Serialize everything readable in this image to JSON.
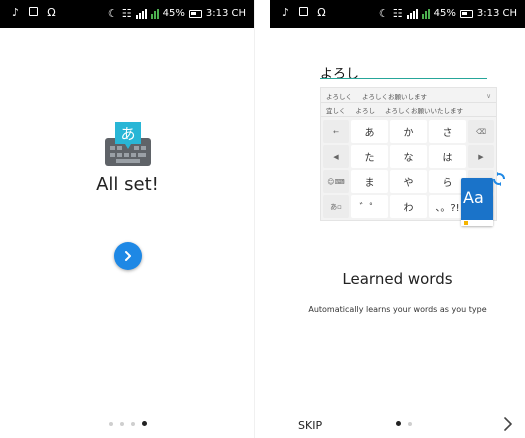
{
  "status_bar": {
    "battery": "45%",
    "time": "3:13 CH"
  },
  "screen_left": {
    "title": "All set!",
    "logo_glyph": "あ",
    "pager": {
      "count": 4,
      "active_index": 3
    }
  },
  "screen_right": {
    "input_text": "よろし",
    "candidates_row1": [
      "よろしく",
      "よろしくお願いします",
      "∨"
    ],
    "candidates_row2": [
      "宜しく",
      "よろし",
      "よろしくお願いいたします"
    ],
    "keys": [
      {
        "label": "←",
        "fn": true
      },
      {
        "label": "あ",
        "fn": false
      },
      {
        "label": "か",
        "fn": false
      },
      {
        "label": "さ",
        "fn": false
      },
      {
        "label": "⌫",
        "fn": true
      },
      {
        "label": "◀",
        "fn": true
      },
      {
        "label": "た",
        "fn": false
      },
      {
        "label": "な",
        "fn": false
      },
      {
        "label": "は",
        "fn": false
      },
      {
        "label": "▶",
        "fn": true
      },
      {
        "label": "☺⌨",
        "fn": true
      },
      {
        "label": "ま",
        "fn": false
      },
      {
        "label": "や",
        "fn": false
      },
      {
        "label": "ら",
        "fn": false
      },
      {
        "label": "",
        "fn": true
      },
      {
        "label": "あ▫",
        "fn": true
      },
      {
        "label": "゛゜",
        "fn": false
      },
      {
        "label": "わ",
        "fn": false
      },
      {
        "label": "、。?!",
        "fn": false
      },
      {
        "label": "",
        "fn": true
      }
    ],
    "card_text": "Aa",
    "title": "Learned words",
    "subtitle": "Automatically learns your words as you type",
    "skip_label": "SKIP",
    "pager": {
      "count": 2,
      "active_index": 0
    }
  },
  "colors": {
    "accent_blue": "#1e88e5",
    "card_blue": "#1a73c9",
    "teal_underline": "#26a69a",
    "signal_green": "#4caf50"
  }
}
